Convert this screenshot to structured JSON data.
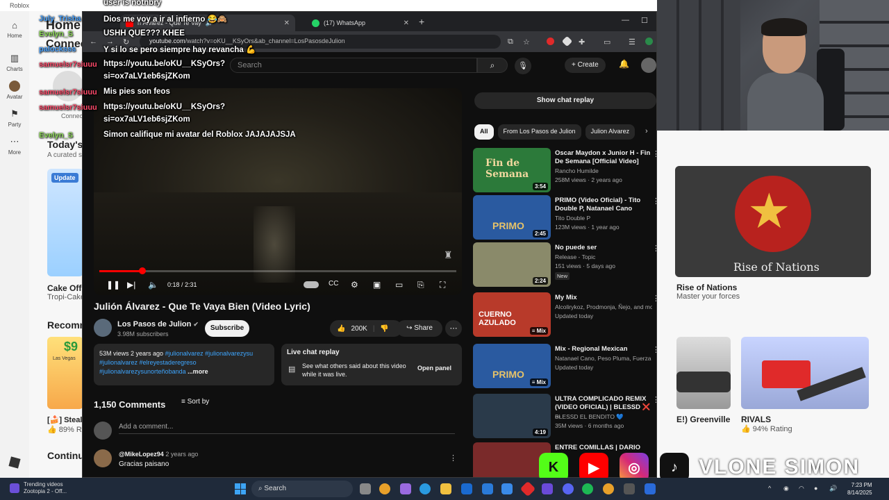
{
  "roblox": {
    "window_title": "Roblox",
    "nav": [
      {
        "label": "Home",
        "icon": "home-icon"
      },
      {
        "label": "Charts",
        "icon": "charts-icon"
      },
      {
        "label": "Avatar",
        "icon": "avatar-icon"
      },
      {
        "label": "Party",
        "icon": "party-icon"
      },
      {
        "label": "More",
        "icon": "more-icon"
      }
    ],
    "home_heading": "Home",
    "connect_heading": "Connec",
    "connect_label": "Connec",
    "todays_heading": "Today's",
    "curated_sub": "A curated s",
    "update_badge": "Update",
    "recommended_heading": "Recomm",
    "continue_heading": "Continu",
    "tiles": [
      {
        "title": "Cake Off!",
        "meta": "Tropi-Cake"
      },
      {
        "title": "[🍰] Steal",
        "meta": "👍 89% Ra"
      },
      {
        "title": "Rise of Nations",
        "meta": "Master your forces"
      },
      {
        "title": "E!) Greenville",
        "meta": ""
      },
      {
        "title": "RIVALS",
        "meta": "👍 94% Rating"
      }
    ],
    "price_badge": "$9",
    "rise_banner": "Rise of Nations",
    "las_vegas_label": "Las Vegas"
  },
  "chat": [
    {
      "user": "",
      "user_color": "#ffffff",
      "text": "user is nothbry"
    },
    {
      "user": "July_Trisha",
      "user_color": "#4aa3ff",
      "text": "Dios me voy a ir al infierno 😂🙈"
    },
    {
      "user": "Evelyn_S",
      "user_color": "#8fdc5a",
      "text": "USHH QUE??? KHEE"
    },
    {
      "user": "palocksss",
      "user_color": "#4aa3ff",
      "text": "Y si lo se pero siempre hay revancha 💪"
    },
    {
      "user": "samuelsr7siuuu",
      "user_color": "#ff4a6a",
      "text": "https://youtu.be/oKU__KSyOrs?"
    },
    {
      "user": "",
      "user_color": "#ffffff",
      "text": "si=ox7aLV1eb6sjZKom"
    },
    {
      "user": "samuelsr7siuuu",
      "user_color": "#ff4a6a",
      "text": "Mis pies son feos"
    },
    {
      "user": "samuelsr7siuuu",
      "user_color": "#ff4a6a",
      "text": "https://youtu.be/oKU__KSyOrs?"
    },
    {
      "user": "",
      "user_color": "#ffffff",
      "text": "si=ox7aLV1eb6sjZKom"
    },
    {
      "user": "Evelyn_S",
      "user_color": "#8fdc5a",
      "text": "Simon califique mi avatar del Roblox JAJAJAJSJA"
    }
  ],
  "browser": {
    "tabs": [
      {
        "label": "n Álvarez - Que Te Vay",
        "active": true
      },
      {
        "label": "(17) WhatsApp",
        "active": false
      }
    ],
    "url_domain": "youtube.com",
    "url_path": "/watch?v=oKU__KSyOrs&ab_channel=LosPasosdeJulion"
  },
  "youtube": {
    "search_placeholder": "Search",
    "create_label": "Create",
    "player": {
      "time": "0:18 / 2:31",
      "progress_fraction": 0.12
    },
    "video_title": "Julión Álvarez - Que Te Vaya Bien (Video Lyric)",
    "channel_name": "Los Pasos de Julion",
    "subscribers": "3.98M subscribers",
    "subscribe_label": "Subscribe",
    "likes": "200K",
    "share_label": "Share",
    "description": {
      "stats": "53M views  2 years ago",
      "tags_line1": "#julionalvarez #julionalvarezysu",
      "tags_line2": "#julionalvarez #elreyestaderegreso",
      "tags_line3": "#julionalvarezysunorteñobanda",
      "more": "...more"
    },
    "live_chat": {
      "title": "Live chat replay",
      "text": "See what others said about this video while it was live.",
      "open_label": "Open panel"
    },
    "comments_count": "1,150 Comments",
    "sort_label": "Sort by",
    "add_comment_placeholder": "Add a comment...",
    "comment": {
      "user": "@MikeLopez94",
      "age": "2 years ago",
      "text": "Gracias paisano"
    },
    "show_chat_replay": "Show chat replay",
    "chips": [
      "All",
      "From Los Pasos de Julion",
      "Julion Alvarez"
    ],
    "recommendations": [
      {
        "title": "Oscar Maydon x Junior H - Fin De Semana [Official Video]",
        "channel": "Rancho Humilde",
        "meta": "258M views · 2 years ago",
        "duration": "3:54",
        "thumb_text": "Fin de Semana",
        "thumb_color": "#2c7a3a"
      },
      {
        "title": "PRIMO (Video Oficial) - Tito Double P, Natanael Cano",
        "channel": "Tito Double P",
        "meta": "123M views · 1 year ago",
        "duration": "2:45",
        "thumb_text": "PRIMO",
        "thumb_color": "#2a5aa0"
      },
      {
        "title": "No puede ser",
        "channel": "Release - Topic",
        "meta": "151 views · 5 days ago",
        "duration": "2:24",
        "badge": "New",
        "thumb_text": "",
        "thumb_color": "#8a8a6a"
      },
      {
        "title": "My Mix",
        "channel": "Alcolirykoz, Prodmonja, Ñejo, and more",
        "meta": "Updated today",
        "duration": "Mix",
        "thumb_text": "CUERNO AZULADO",
        "thumb_color": "#b83a2a"
      },
      {
        "title": "Mix - Regional Mexican",
        "channel": "Natanael Cano, Peso Pluma, Fuerza Regi...",
        "meta": "Updated today",
        "duration": "Mix",
        "thumb_text": "PRIMO",
        "thumb_color": "#2a5aa0"
      },
      {
        "title": "ULTRA COMPLICADO REMIX (VIDEO OFICIAL) | BLESSD ❌ ...",
        "channel": "BLESSD EL BENDITO 💙",
        "meta": "35M views · 6 months ago",
        "duration": "4:19",
        "thumb_text": "",
        "thumb_color": "#2a3a4a"
      },
      {
        "title": "ENTRE COMILLAS | DARIO",
        "channel": "",
        "meta": "",
        "duration": "",
        "thumb_text": "",
        "thumb_color": "#7a2a2a"
      }
    ]
  },
  "social_handle": "VLONE SIMON",
  "taskbar": {
    "news_title": "Trending videos",
    "news_sub": "Zootopia 2 - Off...",
    "search_label": "Search",
    "time": "7:23 PM",
    "date": "8/14/2025"
  },
  "colors": {
    "yt_bg": "#0f0f0f",
    "yt_red": "#ff0000",
    "link_blue": "#3ea6ff"
  }
}
